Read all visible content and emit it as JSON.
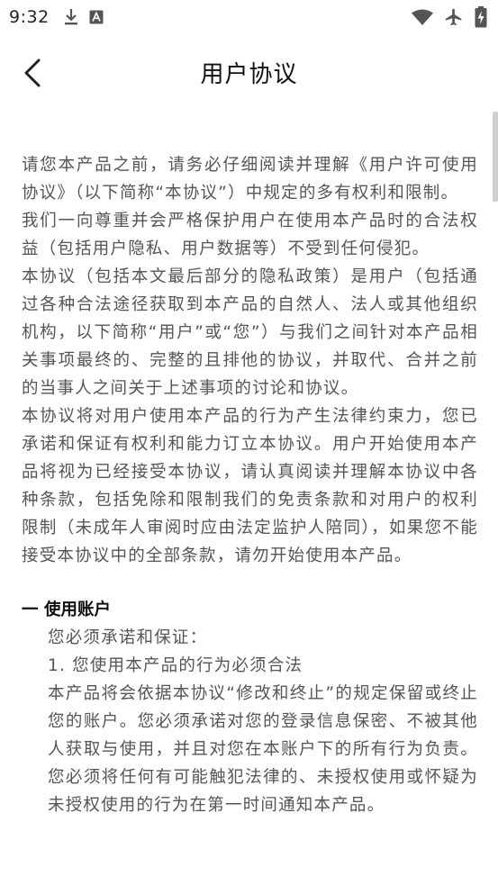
{
  "status_bar": {
    "time": "9:32",
    "left_icons": [
      "download-icon",
      "notification-a-icon"
    ],
    "right_icons": [
      "wifi-icon",
      "airplane-icon",
      "battery-charging-icon"
    ]
  },
  "header": {
    "back_icon": "chevron-left-icon",
    "title": "用户协议"
  },
  "content": {
    "intro_paragraphs": [
      "请您本产品之前，请务必仔细阅读并理解《用户许可使用协议》（以下简称“本协议”）中规定的多有权利和限制。",
      "我们一向尊重并会严格保护用户在使用本产品时的合法权益（包括用户隐私、用户数据等）不受到任何侵犯。",
      "本协议（包括本文最后部分的隐私政策）是用户（包括通过各种合法途径获取到本产品的自然人、法人或其他组织机构，以下简称“用户”或“您”）与我们之间针对本产品相关事项最终的、完整的且排他的协议，并取代、合并之前的当事人之间关于上述事项的讨论和协议。",
      "本协议将对用户使用本产品的行为产生法律约束力，您已承诺和保证有权利和能力订立本协议。用户开始使用本产品将视为已经接受本协议，请认真阅读并理解本协议中各种条款，包括免除和限制我们的免责条款和对用户的权利限制（未成年人审阅时应由法定监护人陪同），如果您不能接受本协议中的全部条款，请勿开始使用本产品。"
    ],
    "section_1": {
      "heading": "一 使用账户",
      "lines": [
        "您必须承诺和保证：",
        "1. 您使用本产品的行为必须合法",
        "本产品将会依据本协议“修改和终止”的规定保留或终止您的账户。您必须承诺对您的登录信息保密、不被其他人获取与使用，并且对您在本账户下的所有行为负责。您必须将任何有可能触犯法律的、未授权使用或怀疑为未授权使用的行为在第一时间通知本产品。"
      ]
    }
  }
}
